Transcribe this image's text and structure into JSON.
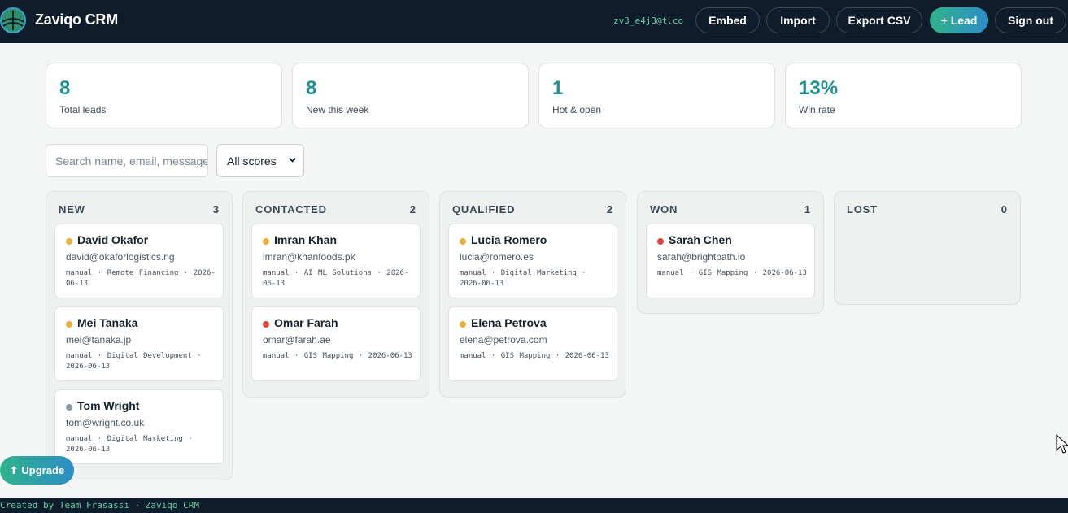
{
  "header": {
    "brand": "Zaviqo CRM",
    "user_email": "zv3_e4j3@t.co",
    "buttons": {
      "embed": "Embed",
      "import": "Import",
      "export": "Export CSV",
      "lead": "+ Lead",
      "sign_out": "Sign out"
    }
  },
  "stats": [
    {
      "value": "8",
      "label": "Total leads"
    },
    {
      "value": "8",
      "label": "New this week"
    },
    {
      "value": "1",
      "label": "Hot & open"
    },
    {
      "value": "13%",
      "label": "Win rate"
    }
  ],
  "filters": {
    "search_placeholder": "Search name, email, message",
    "score_selected": "All scores"
  },
  "columns": [
    {
      "title": "NEW",
      "count": "3",
      "cards": [
        {
          "name": "David Okafor",
          "email": "david@okaforlogistics.ng",
          "meta": "manual · Remote Financing · 2026-06-13",
          "status": "warm"
        },
        {
          "name": "Mei Tanaka",
          "email": "mei@tanaka.jp",
          "meta": "manual · Digital Development · 2026-06-13",
          "status": "warm"
        },
        {
          "name": "Tom Wright",
          "email": "tom@wright.co.uk",
          "meta": "manual · Digital Marketing · 2026-06-13",
          "status": "cold"
        }
      ]
    },
    {
      "title": "CONTACTED",
      "count": "2",
      "cards": [
        {
          "name": "Imran Khan",
          "email": "imran@khanfoods.pk",
          "meta": "manual · AI ML Solutions · 2026-06-13",
          "status": "warm"
        },
        {
          "name": "Omar Farah",
          "email": "omar@farah.ae",
          "meta": "manual · GIS Mapping · 2026-06-13",
          "status": "hot"
        }
      ]
    },
    {
      "title": "QUALIFIED",
      "count": "2",
      "cards": [
        {
          "name": "Lucia Romero",
          "email": "lucia@romero.es",
          "meta": "manual · Digital Marketing · 2026-06-13",
          "status": "warm"
        },
        {
          "name": "Elena Petrova",
          "email": "elena@petrova.com",
          "meta": "manual · GIS Mapping · 2026-06-13",
          "status": "warm"
        }
      ]
    },
    {
      "title": "WON",
      "count": "1",
      "cards": [
        {
          "name": "Sarah Chen",
          "email": "sarah@brightpath.io",
          "meta": "manual · GIS Mapping · 2026-06-13",
          "status": "hot"
        }
      ]
    },
    {
      "title": "LOST",
      "count": "0",
      "cards": []
    }
  ],
  "status_colors": {
    "hot": "#e0463c",
    "warm": "#e8b23a",
    "cold": "#8a9aa8"
  },
  "upgrade_label": "⬆ Upgrade",
  "footer_text": "Created by Team Frasassi · Zaviqo CRM"
}
